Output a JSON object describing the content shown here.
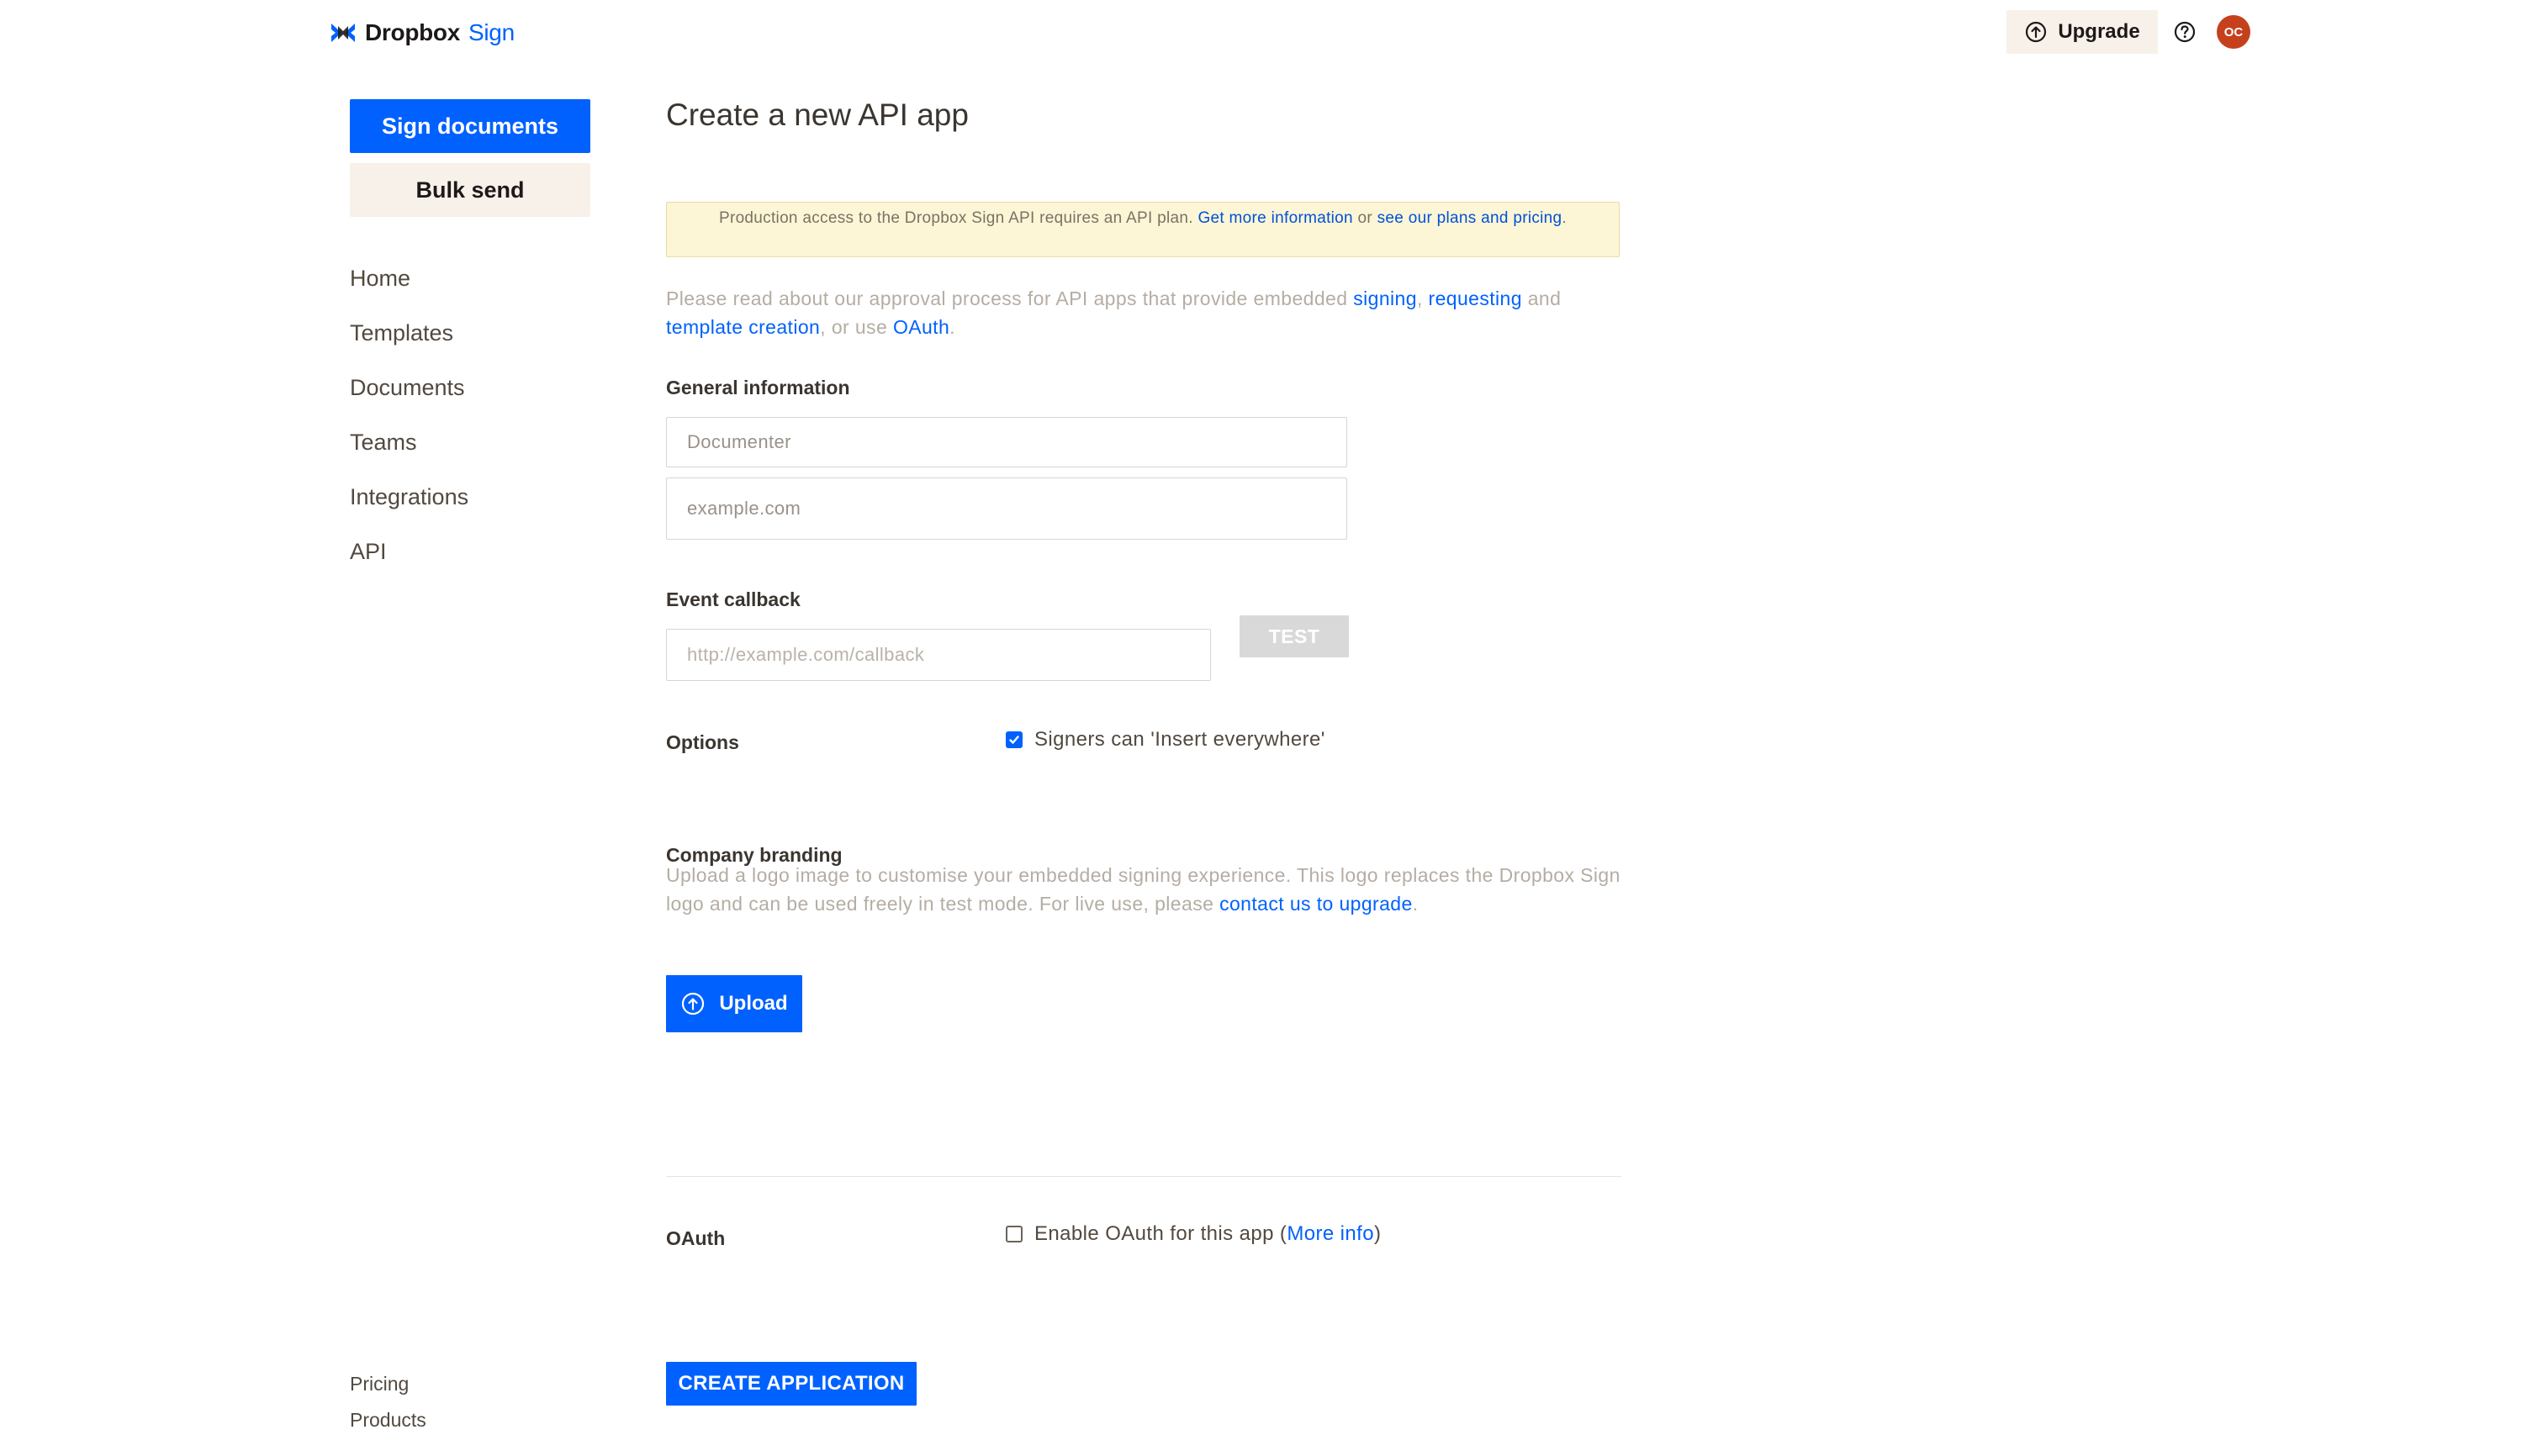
{
  "header": {
    "brand_name": "Dropbox",
    "brand_product": "Sign",
    "upgrade_label": "Upgrade",
    "avatar_initials": "OC"
  },
  "sidebar": {
    "sign_documents_label": "Sign documents",
    "bulk_send_label": "Bulk send",
    "nav": [
      {
        "label": "Home"
      },
      {
        "label": "Templates"
      },
      {
        "label": "Documents"
      },
      {
        "label": "Teams"
      },
      {
        "label": "Integrations"
      },
      {
        "label": "API"
      }
    ],
    "footer": [
      {
        "label": "Pricing"
      },
      {
        "label": "Products"
      }
    ]
  },
  "main": {
    "title": "Create a new API app",
    "notice": {
      "text_1": "Production access to the Dropbox Sign API requires an API plan.",
      "link_more_info": "Get more information",
      "text_or": "or",
      "link_plans": "see our plans and pricing",
      "text_end": "."
    },
    "intro": {
      "text_1": "Please read about our approval process for API apps that provide embedded",
      "link_signing": "signing",
      "comma": ",",
      "link_requesting": "requesting",
      "text_and": "and",
      "link_template": "template creation",
      "text_use": ", or use",
      "link_oauth": "OAuth",
      "period": "."
    },
    "general_info": {
      "label": "General information",
      "name_placeholder": "Documenter",
      "domain_placeholder": "example.com"
    },
    "event_callback": {
      "label": "Event callback",
      "placeholder": "http://example.com/callback",
      "test_label": "TEST"
    },
    "options": {
      "label": "Options",
      "insert_everywhere_label": "Signers can 'Insert everywhere'",
      "insert_everywhere_checked": true
    },
    "branding": {
      "label": "Company branding",
      "text_1": "Upload a logo image to customise your embedded signing experience. This logo replaces the Dropbox Sign logo and can be used freely in test mode. For live use, please",
      "link_contact": "contact us to upgrade",
      "period": ".",
      "upload_label": "Upload"
    },
    "oauth": {
      "label": "OAuth",
      "enable_text": "Enable OAuth for this app (",
      "more_info_link": "More info",
      "close_paren": ")",
      "checked": false
    },
    "create_label": "CREATE APPLICATION"
  },
  "colors": {
    "accent": "#0061fe",
    "beige": "#f7f1ea",
    "avatar": "#c4411c",
    "notice_bg": "#fcf6d6"
  },
  "icons": {
    "brand": "dropbox-sign-logo-icon",
    "upgrade": "arrow-up-circle-icon",
    "help": "question-circle-icon",
    "upload": "arrow-up-circle-icon",
    "checkbox": "checkmark-icon"
  }
}
